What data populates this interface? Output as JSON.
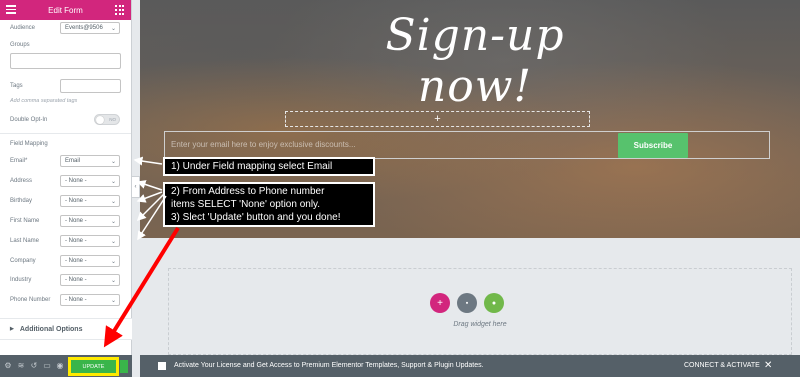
{
  "sidebar": {
    "title": "Edit Form",
    "fields": {
      "audience_label": "Audience",
      "audience_value": "Events@9506",
      "groups_label": "Groups",
      "tags_label": "Tags",
      "tags_hint": "Add comma separated tags",
      "double_optin_label": "Double Opt-In",
      "double_optin_state": "NO"
    },
    "field_mapping_title": "Field Mapping",
    "mappings": [
      {
        "label": "Email*",
        "value": "Email"
      },
      {
        "label": "Address",
        "value": "- None -"
      },
      {
        "label": "Birthday",
        "value": "- None -"
      },
      {
        "label": "First Name",
        "value": "- None -"
      },
      {
        "label": "Last Name",
        "value": "- None -"
      },
      {
        "label": "Company",
        "value": "- None -"
      },
      {
        "label": "Industry",
        "value": "- None -"
      },
      {
        "label": "Phone Number",
        "value": "- None -"
      }
    ],
    "advanced_options": "Additional Options",
    "update_label": "UPDATE"
  },
  "hero": {
    "title": "Sign-up now!",
    "add_section": "+",
    "email_placeholder": "Enter your email here to enjoy exclusive discounts...",
    "subscribe_label": "Subscribe"
  },
  "drop_zone": {
    "drag_text": "Drag widget here",
    "plus_icon": "+",
    "folder_icon": "▪",
    "leaf_icon": "●"
  },
  "notice": {
    "text": "Activate Your License and Get Access to Premium Elementor Templates, Support & Plugin Updates.",
    "cta": "CONNECT & ACTIVATE",
    "close": "✕"
  },
  "annotations": {
    "note1": "1)  Under Field mapping select Email",
    "note2_line1": "2) From Address to Phone number",
    "note2_line2": "items SELECT 'None' option only.",
    "note2_line3": "3) Slect 'Update' button and you done!"
  },
  "colors": {
    "brand_pink": "#d2267d",
    "update_green": "#39b54a",
    "subscribe_green": "#57c26d",
    "arrow_red": "#ff0000",
    "highlight_yellow": "#ffea00"
  }
}
